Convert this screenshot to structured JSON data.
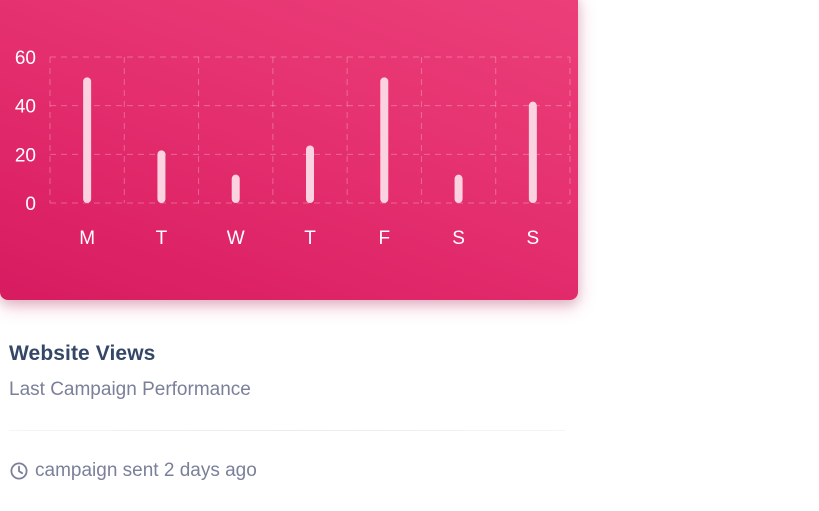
{
  "card": {
    "title": "Website Views",
    "subtitle": "Last Campaign Performance",
    "footer_text": "campaign sent 2 days ago",
    "footer_icon": "clock-icon"
  },
  "colors": {
    "header_gradient_start": "#ec407a",
    "header_gradient_end": "#d81b60",
    "bar": "#fbd3e0",
    "title": "#344767",
    "muted": "#7b809a"
  },
  "chart_data": {
    "type": "bar",
    "categories": [
      "M",
      "T",
      "W",
      "T",
      "F",
      "S",
      "S"
    ],
    "values": [
      50,
      20,
      10,
      22,
      50,
      10,
      40
    ],
    "title": "",
    "xlabel": "",
    "ylabel": "",
    "ylim": [
      0,
      60
    ],
    "yticks": [
      0,
      20,
      40,
      60
    ],
    "grid": true
  }
}
